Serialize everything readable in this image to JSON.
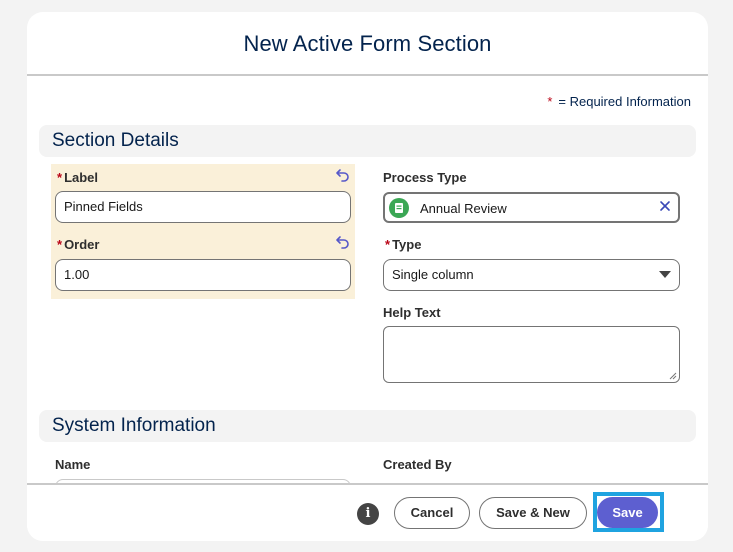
{
  "modal": {
    "title": "New Active Form Section"
  },
  "required_info": {
    "star": "*",
    "text": "= Required Information"
  },
  "sections": {
    "details": "Section Details",
    "system": "System Information"
  },
  "fields": {
    "label": {
      "required": "*",
      "label": "Label",
      "value": "Pinned Fields"
    },
    "order": {
      "required": "*",
      "label": "Order",
      "value": "1.00"
    },
    "process_type": {
      "label": "Process Type",
      "value": "Annual Review",
      "icon": "record-icon"
    },
    "type": {
      "required": "*",
      "label": "Type",
      "value": "Single column",
      "options": [
        "Single column"
      ]
    },
    "help_text": {
      "label": "Help Text",
      "value": ""
    },
    "name": {
      "label": "Name",
      "value": ""
    },
    "created_by": {
      "label": "Created By"
    }
  },
  "footer": {
    "info_glyph": "i",
    "cancel": "Cancel",
    "save_new": "Save & New",
    "save": "Save"
  },
  "colors": {
    "accent": "#5d5fd0",
    "focus_ring": "#1fa3e0",
    "required": "#ba0517",
    "highlight": "#faf0d9",
    "title": "#03234d"
  }
}
